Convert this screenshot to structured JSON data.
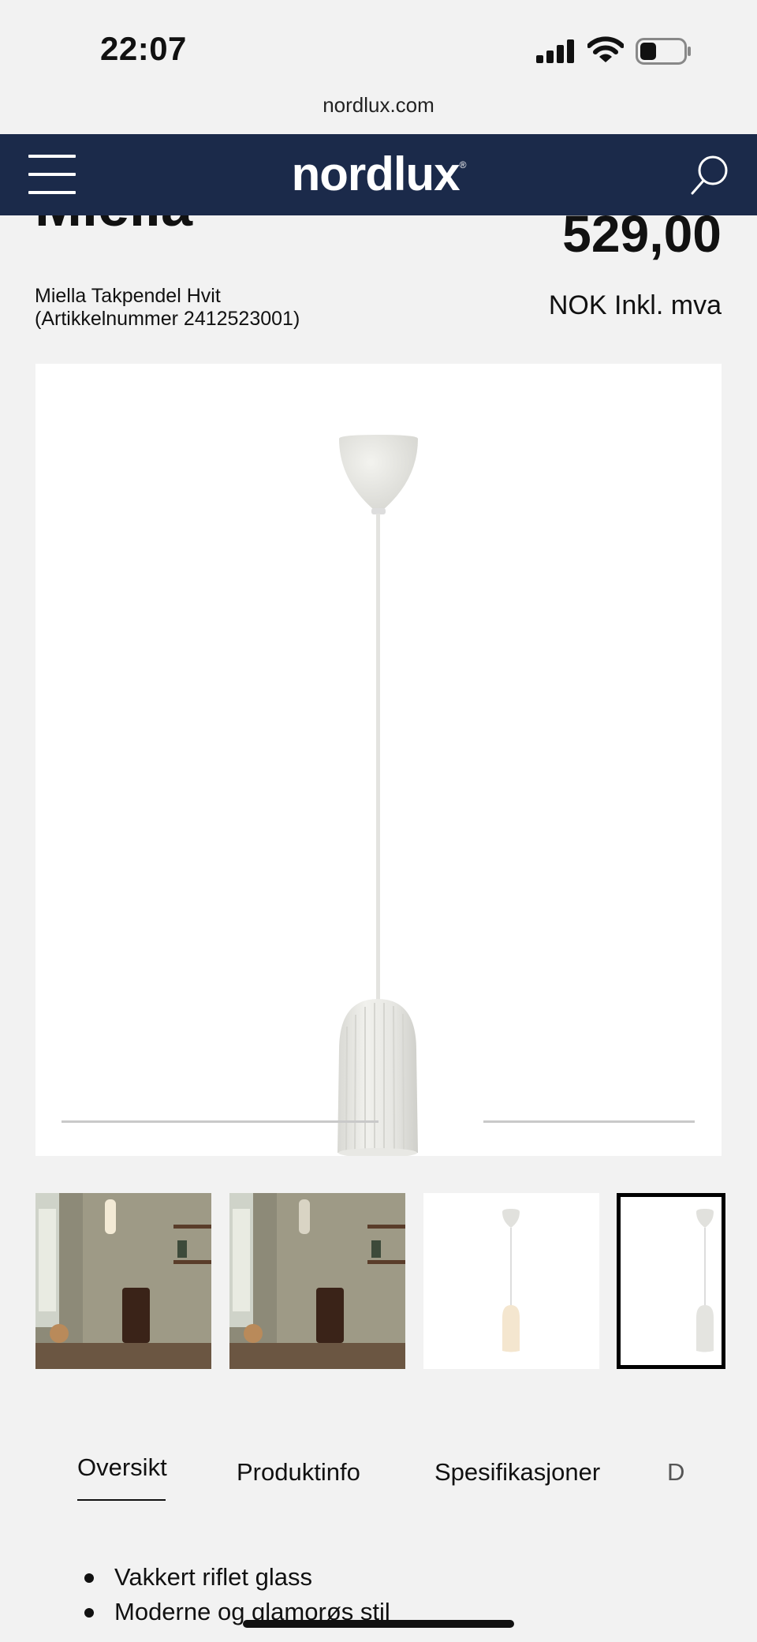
{
  "status_bar": {
    "time": "22:07",
    "icons": [
      "signal-icon",
      "wifi-icon",
      "battery-icon"
    ]
  },
  "browser": {
    "url": "nordlux.com"
  },
  "header": {
    "logo": "nordlux",
    "logo_mark": "®",
    "background": "#1b2a4a",
    "icons": [
      "menu-icon",
      "search-icon"
    ]
  },
  "product": {
    "title": "Miella",
    "price": "529,00",
    "currency_note": "NOK Inkl. mva",
    "name_line1": "Miella Takpendel Hvit",
    "name_line2": "(Artikkelnummer 2412523001)"
  },
  "gallery": {
    "thumbnails": [
      "room-photo",
      "room-photo",
      "product-photo",
      "product-photo"
    ],
    "selected_index": 3
  },
  "tabs": [
    {
      "label": "Oversikt",
      "active": true
    },
    {
      "label": "Produktinfo",
      "active": false
    },
    {
      "label": "Spesifikasjoner",
      "active": false
    },
    {
      "label": "D",
      "active": false
    }
  ],
  "features": [
    "Vakkert riflet glass",
    "Moderne og glamorøs stil"
  ]
}
